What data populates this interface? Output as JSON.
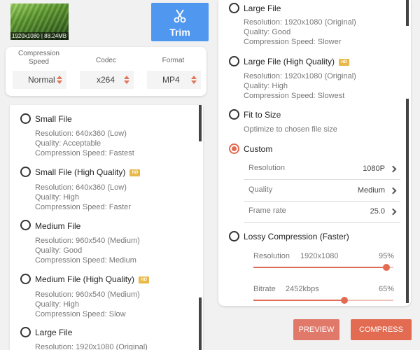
{
  "video": {
    "thumbnail_label": "1920x1080 | 88.24MB"
  },
  "trim_button": {
    "label": "Trim",
    "icon": "scissors-icon"
  },
  "settings": {
    "compression_speed": {
      "title_line1": "Compression",
      "title_line2": "Speed",
      "value": "Normal"
    },
    "codec": {
      "title": "Codec",
      "value": "x264"
    },
    "format": {
      "title": "Format",
      "value": "MP4"
    }
  },
  "left_options": [
    {
      "title": "Small File",
      "hd": false,
      "resolution": "Resolution: 640x360 (Low)",
      "quality": "Quality: Acceptable",
      "speed": "Compression Speed: Fastest"
    },
    {
      "title": "Small File (High Quality)",
      "hd": true,
      "hd_badge": "HD",
      "resolution": "Resolution: 640x360 (Low)",
      "quality": "Quality: High",
      "speed": "Compression Speed: Faster"
    },
    {
      "title": "Medium File",
      "hd": false,
      "resolution": "Resolution: 960x540 (Medium)",
      "quality": "Quality: Good",
      "speed": "Compression Speed: Medium"
    },
    {
      "title": "Medium File (High Quality)",
      "hd": true,
      "hd_badge": "HD",
      "resolution": "Resolution: 960x540 (Medium)",
      "quality": "Quality: High",
      "speed": "Compression Speed: Slow"
    },
    {
      "title": "Large File",
      "hd": false,
      "resolution": "Resolution: 1920x1080 (Original)"
    }
  ],
  "right_options": {
    "large_file": {
      "title": "Large File",
      "resolution": "Resolution: 1920x1080 (Original)",
      "quality": "Quality: Good",
      "speed": "Compression Speed: Slower"
    },
    "large_file_hq": {
      "title": "Large File (High Quality)",
      "hd_badge": "HD",
      "resolution": "Resolution: 1920x1080 (Original)",
      "quality": "Quality: High",
      "speed": "Compression Speed: Slowest"
    },
    "fit_to_size": {
      "title": "Fit to Size",
      "description": "Optimize to chosen file size"
    },
    "custom": {
      "title": "Custom",
      "selected": true,
      "rows": [
        {
          "label": "Resolution",
          "value": "1080P"
        },
        {
          "label": "Quality",
          "value": "Medium"
        },
        {
          "label": "Frame rate",
          "value": "25.0"
        }
      ]
    },
    "lossy": {
      "title": "Lossy Compression (Faster)",
      "resolution": {
        "label": "Resolution",
        "value": "1920x1080",
        "percent_label": "95%",
        "percent": 95
      },
      "bitrate": {
        "label": "Bitrate",
        "value": "2452kbps",
        "percent_label": "65%",
        "percent": 65
      }
    }
  },
  "actions": {
    "preview": "PREVIEW",
    "compress": "COMPRESS"
  },
  "colors": {
    "accent": "#e26b52",
    "trim_blue": "#4f97ef",
    "hd_badge": "#e7b94a"
  }
}
